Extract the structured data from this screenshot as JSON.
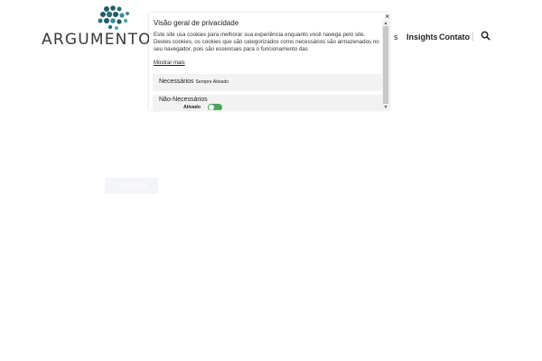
{
  "header": {
    "logo_text": "ARGUMENTOS",
    "nav_partial": "s",
    "nav": [
      {
        "label": "Insights"
      },
      {
        "label": "Contato"
      }
    ]
  },
  "page": {
    "ghost_button_label": "Continuar"
  },
  "cookie_modal": {
    "title": "Visão geral de privacidade",
    "body": "Este site usa cookies para melhorar sua experiência enquanto você navega pelo site. Destes cookies, os cookies que são categorizados como necessários são armazenados no seu navegador, pois são essenciais para o funcionamento das",
    "show_more": "Mostrar mais",
    "close": "×",
    "sections": [
      {
        "title": "Necessários",
        "status": "Sempre Ativado"
      },
      {
        "title": "Não-Necessários",
        "toggle_label": "Ativado",
        "toggle_on": true
      }
    ]
  },
  "colors": {
    "logo_dots": "#1f5b66",
    "toggle": "#4aa657"
  },
  "icons": {
    "search": "search-icon",
    "close": "close-icon"
  }
}
